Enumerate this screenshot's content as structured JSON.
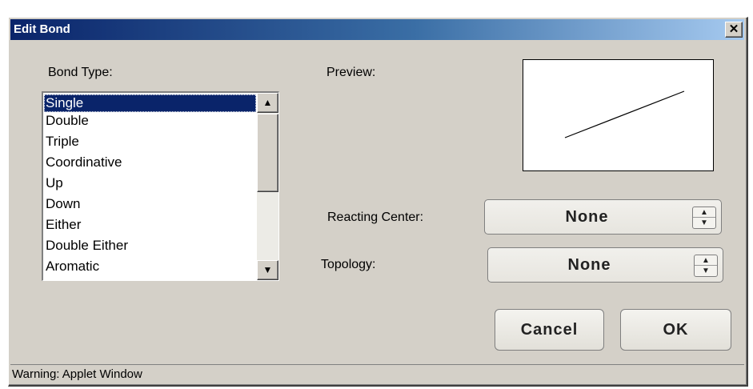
{
  "window": {
    "title": "Edit Bond"
  },
  "bond_type": {
    "label": "Bond Type:",
    "items": [
      "Single",
      "Double",
      "Triple",
      "Coordinative",
      "Up",
      "Down",
      "Either",
      "Double Either",
      "Aromatic"
    ],
    "selected": "Single"
  },
  "preview": {
    "label": "Preview:"
  },
  "reacting_center": {
    "label": "Reacting Center:",
    "value": "None"
  },
  "topology": {
    "label": "Topology:",
    "value": "None"
  },
  "buttons": {
    "cancel": "Cancel",
    "ok": "OK"
  },
  "status": {
    "text": "Warning: Applet Window"
  },
  "icons": {
    "close": "close-icon",
    "scroll_up": "arrow-up-icon",
    "scroll_down": "arrow-down-icon",
    "spin_up": "spin-up-icon",
    "spin_down": "spin-down-icon"
  },
  "colors": {
    "title_start": "#0a246a",
    "title_end": "#a6caf0",
    "selection": "#0a246a",
    "dialog_bg": "#d4d0c8"
  }
}
